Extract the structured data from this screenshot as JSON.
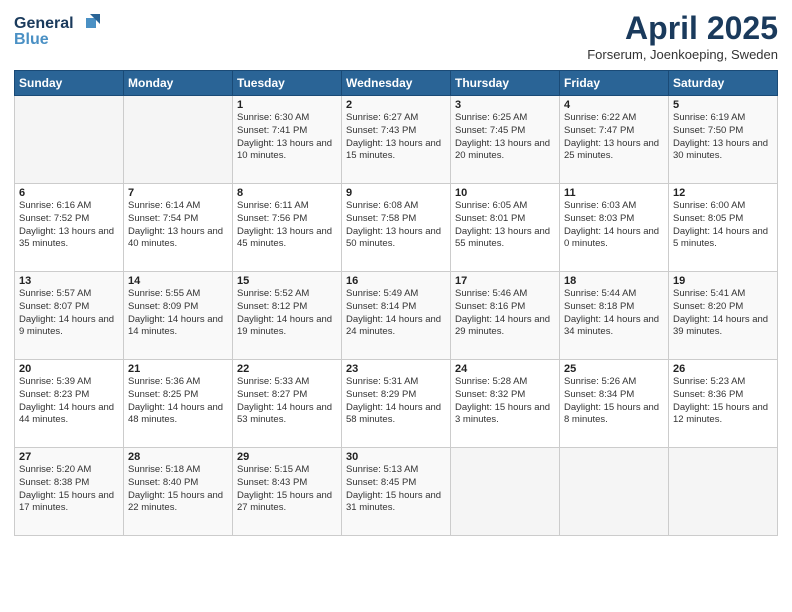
{
  "logo": {
    "line1": "General",
    "line2": "Blue"
  },
  "title": "April 2025",
  "subtitle": "Forserum, Joenkoeping, Sweden",
  "days_of_week": [
    "Sunday",
    "Monday",
    "Tuesday",
    "Wednesday",
    "Thursday",
    "Friday",
    "Saturday"
  ],
  "weeks": [
    [
      {
        "day": "",
        "info": ""
      },
      {
        "day": "",
        "info": ""
      },
      {
        "day": "1",
        "info": "Sunrise: 6:30 AM\nSunset: 7:41 PM\nDaylight: 13 hours and 10 minutes."
      },
      {
        "day": "2",
        "info": "Sunrise: 6:27 AM\nSunset: 7:43 PM\nDaylight: 13 hours and 15 minutes."
      },
      {
        "day": "3",
        "info": "Sunrise: 6:25 AM\nSunset: 7:45 PM\nDaylight: 13 hours and 20 minutes."
      },
      {
        "day": "4",
        "info": "Sunrise: 6:22 AM\nSunset: 7:47 PM\nDaylight: 13 hours and 25 minutes."
      },
      {
        "day": "5",
        "info": "Sunrise: 6:19 AM\nSunset: 7:50 PM\nDaylight: 13 hours and 30 minutes."
      }
    ],
    [
      {
        "day": "6",
        "info": "Sunrise: 6:16 AM\nSunset: 7:52 PM\nDaylight: 13 hours and 35 minutes."
      },
      {
        "day": "7",
        "info": "Sunrise: 6:14 AM\nSunset: 7:54 PM\nDaylight: 13 hours and 40 minutes."
      },
      {
        "day": "8",
        "info": "Sunrise: 6:11 AM\nSunset: 7:56 PM\nDaylight: 13 hours and 45 minutes."
      },
      {
        "day": "9",
        "info": "Sunrise: 6:08 AM\nSunset: 7:58 PM\nDaylight: 13 hours and 50 minutes."
      },
      {
        "day": "10",
        "info": "Sunrise: 6:05 AM\nSunset: 8:01 PM\nDaylight: 13 hours and 55 minutes."
      },
      {
        "day": "11",
        "info": "Sunrise: 6:03 AM\nSunset: 8:03 PM\nDaylight: 14 hours and 0 minutes."
      },
      {
        "day": "12",
        "info": "Sunrise: 6:00 AM\nSunset: 8:05 PM\nDaylight: 14 hours and 5 minutes."
      }
    ],
    [
      {
        "day": "13",
        "info": "Sunrise: 5:57 AM\nSunset: 8:07 PM\nDaylight: 14 hours and 9 minutes."
      },
      {
        "day": "14",
        "info": "Sunrise: 5:55 AM\nSunset: 8:09 PM\nDaylight: 14 hours and 14 minutes."
      },
      {
        "day": "15",
        "info": "Sunrise: 5:52 AM\nSunset: 8:12 PM\nDaylight: 14 hours and 19 minutes."
      },
      {
        "day": "16",
        "info": "Sunrise: 5:49 AM\nSunset: 8:14 PM\nDaylight: 14 hours and 24 minutes."
      },
      {
        "day": "17",
        "info": "Sunrise: 5:46 AM\nSunset: 8:16 PM\nDaylight: 14 hours and 29 minutes."
      },
      {
        "day": "18",
        "info": "Sunrise: 5:44 AM\nSunset: 8:18 PM\nDaylight: 14 hours and 34 minutes."
      },
      {
        "day": "19",
        "info": "Sunrise: 5:41 AM\nSunset: 8:20 PM\nDaylight: 14 hours and 39 minutes."
      }
    ],
    [
      {
        "day": "20",
        "info": "Sunrise: 5:39 AM\nSunset: 8:23 PM\nDaylight: 14 hours and 44 minutes."
      },
      {
        "day": "21",
        "info": "Sunrise: 5:36 AM\nSunset: 8:25 PM\nDaylight: 14 hours and 48 minutes."
      },
      {
        "day": "22",
        "info": "Sunrise: 5:33 AM\nSunset: 8:27 PM\nDaylight: 14 hours and 53 minutes."
      },
      {
        "day": "23",
        "info": "Sunrise: 5:31 AM\nSunset: 8:29 PM\nDaylight: 14 hours and 58 minutes."
      },
      {
        "day": "24",
        "info": "Sunrise: 5:28 AM\nSunset: 8:32 PM\nDaylight: 15 hours and 3 minutes."
      },
      {
        "day": "25",
        "info": "Sunrise: 5:26 AM\nSunset: 8:34 PM\nDaylight: 15 hours and 8 minutes."
      },
      {
        "day": "26",
        "info": "Sunrise: 5:23 AM\nSunset: 8:36 PM\nDaylight: 15 hours and 12 minutes."
      }
    ],
    [
      {
        "day": "27",
        "info": "Sunrise: 5:20 AM\nSunset: 8:38 PM\nDaylight: 15 hours and 17 minutes."
      },
      {
        "day": "28",
        "info": "Sunrise: 5:18 AM\nSunset: 8:40 PM\nDaylight: 15 hours and 22 minutes."
      },
      {
        "day": "29",
        "info": "Sunrise: 5:15 AM\nSunset: 8:43 PM\nDaylight: 15 hours and 27 minutes."
      },
      {
        "day": "30",
        "info": "Sunrise: 5:13 AM\nSunset: 8:45 PM\nDaylight: 15 hours and 31 minutes."
      },
      {
        "day": "",
        "info": ""
      },
      {
        "day": "",
        "info": ""
      },
      {
        "day": "",
        "info": ""
      }
    ]
  ]
}
